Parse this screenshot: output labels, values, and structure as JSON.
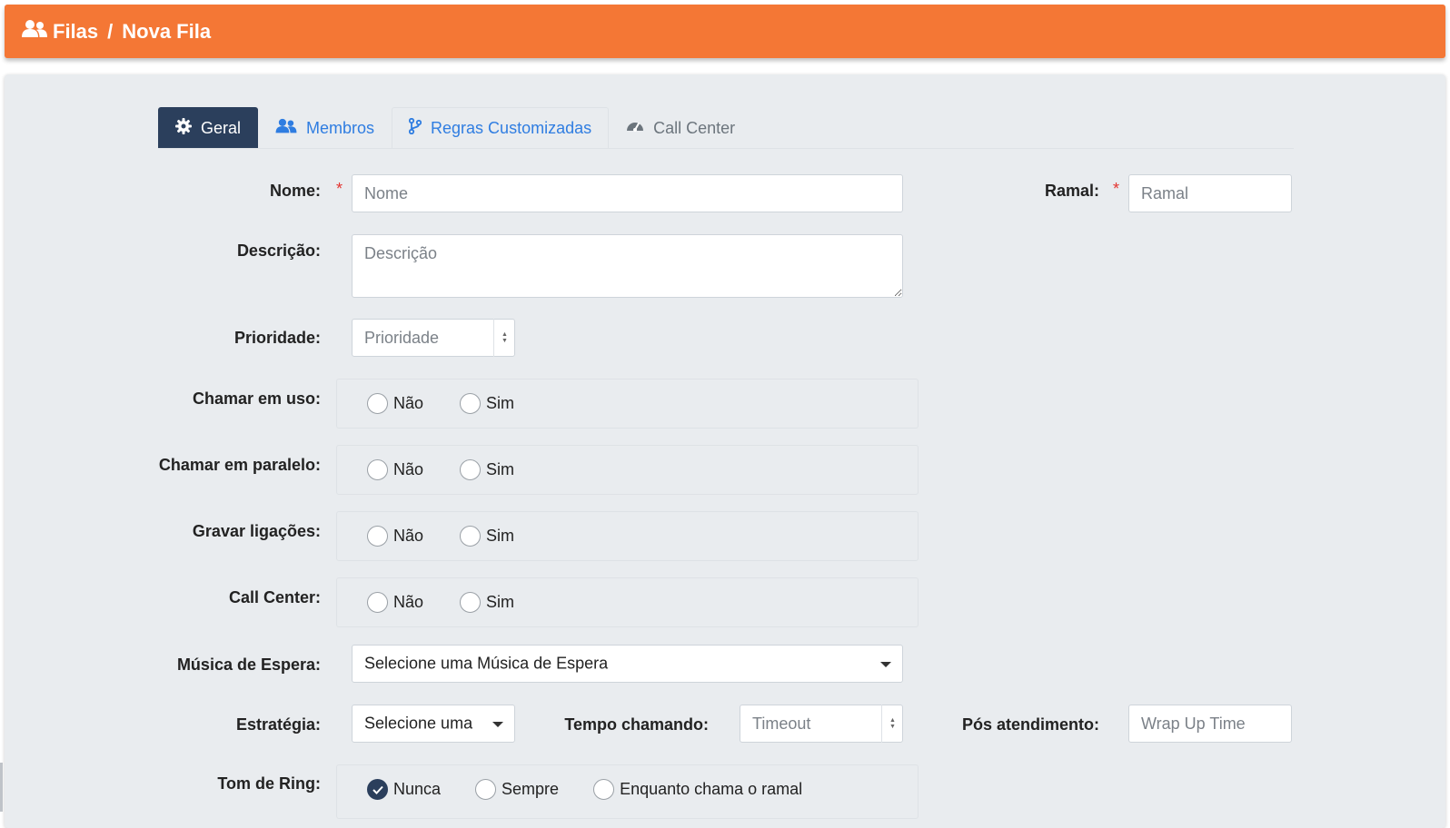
{
  "header": {
    "icon": "users-icon",
    "section": "Filas",
    "separator": "/",
    "title": "Nova Fila"
  },
  "tabs": [
    {
      "label": "Geral",
      "icon": "gear-icon",
      "active": true
    },
    {
      "label": "Membros",
      "icon": "users-icon"
    },
    {
      "label": "Regras Customizadas",
      "icon": "branch-icon"
    },
    {
      "label": "Call Center",
      "icon": "gauge-icon",
      "disabled": true
    }
  ],
  "form": {
    "required_mark": "*",
    "nome": {
      "label": "Nome:",
      "placeholder": "Nome",
      "value": ""
    },
    "ramal": {
      "label": "Ramal:",
      "placeholder": "Ramal",
      "value": ""
    },
    "descricao": {
      "label": "Descrição:",
      "placeholder": "Descrição",
      "value": ""
    },
    "prioridade": {
      "label": "Prioridade:",
      "placeholder": "Prioridade"
    },
    "chamar_em_uso": {
      "label": "Chamar em uso:",
      "options": [
        "Não",
        "Sim"
      ]
    },
    "chamar_em_paralelo": {
      "label": "Chamar em paralelo:",
      "options": [
        "Não",
        "Sim"
      ]
    },
    "gravar_ligacoes": {
      "label": "Gravar ligações:",
      "options": [
        "Não",
        "Sim"
      ]
    },
    "call_center": {
      "label": "Call Center:",
      "options": [
        "Não",
        "Sim"
      ]
    },
    "musica_espera": {
      "label": "Música de Espera:",
      "selected": "Selecione uma Música de Espera"
    },
    "estrategia": {
      "label": "Estratégia:",
      "selected": "Selecione uma"
    },
    "tempo_chamando": {
      "label": "Tempo chamando:",
      "placeholder": "Timeout"
    },
    "pos_atendimento": {
      "label": "Pós atendimento:",
      "placeholder": "Wrap Up Time"
    },
    "tom_de_ring": {
      "label": "Tom de Ring:",
      "options": [
        "Nunca",
        "Sempre",
        "Enquanto chama o ramal"
      ],
      "selected": "Nunca"
    }
  },
  "colors": {
    "header": "#f47735",
    "active_tab": "#2b3f5c",
    "link": "#2f7de1",
    "required": "#e3342f",
    "panel": "#e9ecef"
  }
}
